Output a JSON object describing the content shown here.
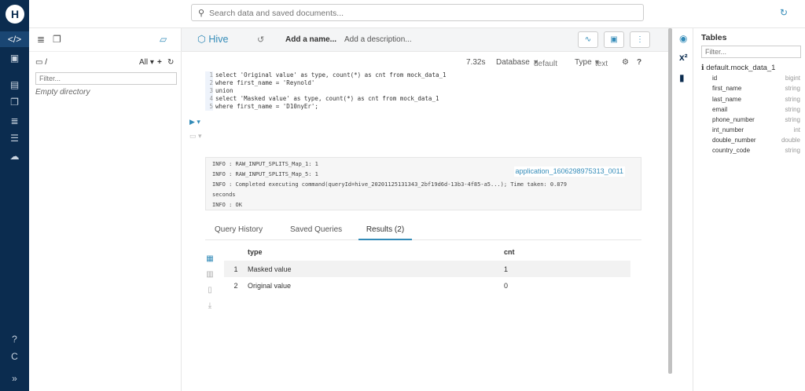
{
  "topbar": {
    "search_placeholder": "Search data and saved documents..."
  },
  "assist": {
    "path": "/",
    "all_label": "All",
    "filter_placeholder": "Filter...",
    "empty_text": "Empty directory"
  },
  "editor": {
    "app_name": "Hive",
    "name_placeholder": "Add a name...",
    "desc_placeholder": "Add a description...",
    "exec_time": "7.32s",
    "database_label": "Database",
    "database_value": "default",
    "type_label": "Type",
    "type_value": "text",
    "code_lines": [
      "select 'Original value' as type, count(*) as cnt from mock_data_1",
      "where first_name = 'Reynold'",
      "union",
      "select 'Masked value' as type, count(*) as cnt from mock_data_1",
      "where first_name = 'D10nyEr';"
    ]
  },
  "logs": {
    "lines": [
      "INFO  :    RAW_INPUT_SPLITS_Map_1: 1",
      "INFO  :    RAW_INPUT_SPLITS_Map_5: 1",
      "INFO  : Completed executing command(queryId=hive_20201125131343_2bf19d6d-13b3-4f85-a5...); Time taken: 0.879",
      "seconds",
      "INFO  : OK"
    ],
    "application": "application_1606298975313_0011"
  },
  "results": {
    "tabs": [
      "Query History",
      "Saved Queries",
      "Results (2)"
    ],
    "columns": [
      "type",
      "cnt"
    ],
    "rows": [
      {
        "n": "1",
        "type": "Masked value",
        "cnt": "1"
      },
      {
        "n": "2",
        "type": "Original value",
        "cnt": "0"
      }
    ]
  },
  "tables": {
    "title": "Tables",
    "filter_placeholder": "Filter...",
    "table_name": "default.mock_data_1",
    "columns": [
      {
        "name": "id",
        "type": "bigint"
      },
      {
        "name": "first_name",
        "type": "string"
      },
      {
        "name": "last_name",
        "type": "string"
      },
      {
        "name": "email",
        "type": "string"
      },
      {
        "name": "phone_number",
        "type": "string"
      },
      {
        "name": "int_number",
        "type": "int"
      },
      {
        "name": "double_number",
        "type": "double"
      },
      {
        "name": "country_code",
        "type": "string"
      }
    ]
  },
  "colors": {
    "nav_bg": "#0B2C4F",
    "accent": "#338bb8"
  }
}
